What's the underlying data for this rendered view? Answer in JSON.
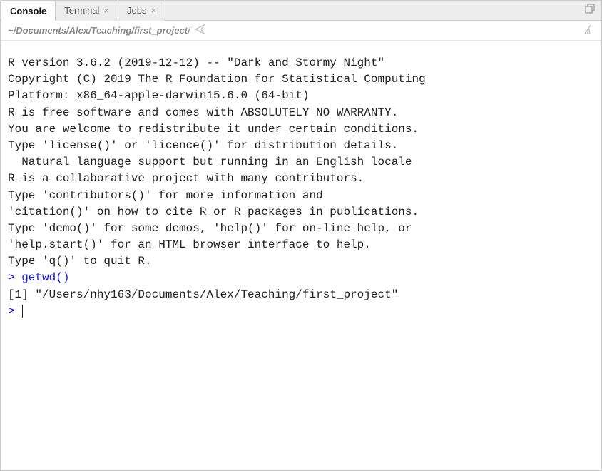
{
  "tabs": [
    {
      "label": "Console",
      "closable": false,
      "active": true
    },
    {
      "label": "Terminal",
      "closable": true,
      "active": false
    },
    {
      "label": "Jobs",
      "closable": true,
      "active": false
    }
  ],
  "pathbar": {
    "path": "~/Documents/Alex/Teaching/first_project/"
  },
  "console": {
    "banner": [
      "",
      "R version 3.6.2 (2019-12-12) -- \"Dark and Stormy Night\"",
      "Copyright (C) 2019 The R Foundation for Statistical Computing",
      "Platform: x86_64-apple-darwin15.6.0 (64-bit)",
      "",
      "R is free software and comes with ABSOLUTELY NO WARRANTY.",
      "You are welcome to redistribute it under certain conditions.",
      "Type 'license()' or 'licence()' for distribution details.",
      "",
      "  Natural language support but running in an English locale",
      "",
      "R is a collaborative project with many contributors.",
      "Type 'contributors()' for more information and",
      "'citation()' on how to cite R or R packages in publications.",
      "",
      "Type 'demo()' for some demos, 'help()' for on-line help, or",
      "'help.start()' for an HTML browser interface to help.",
      "Type 'q()' to quit R.",
      ""
    ],
    "entries": [
      {
        "prompt": ">",
        "command": "getwd()",
        "output": "[1] \"/Users/nhy163/Documents/Alex/Teaching/first_project\""
      }
    ],
    "current_prompt": ">"
  }
}
